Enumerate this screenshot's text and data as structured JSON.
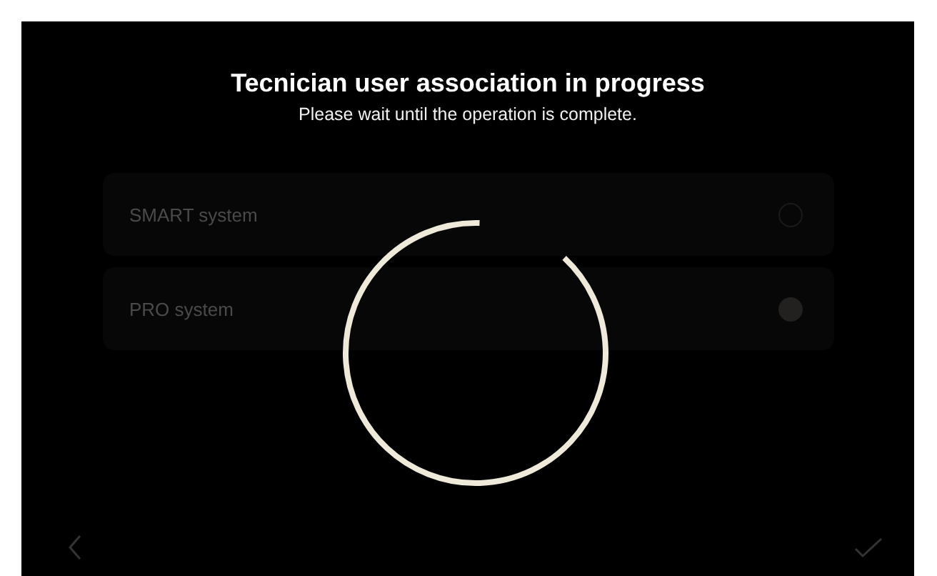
{
  "options": [
    {
      "label": "SMART system",
      "selected": false
    },
    {
      "label": "PRO system",
      "selected": true
    }
  ],
  "overlay": {
    "title": "Tecnician user association in progress",
    "message": "Please wait until the operation is complete."
  }
}
